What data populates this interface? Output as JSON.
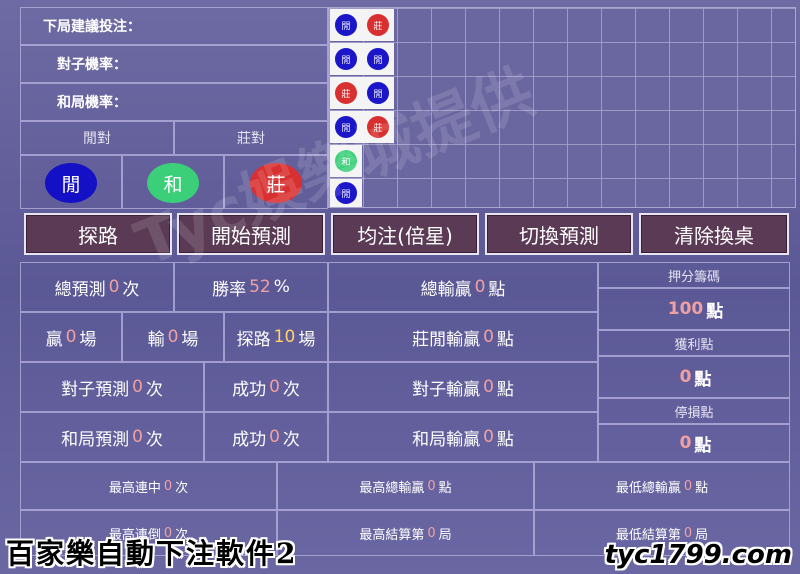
{
  "labels": {
    "next_bet": "下局建議投注：",
    "pair_rate": "對子機率：",
    "tie_rate": "和局機率："
  },
  "pairs": {
    "player_pair": "閒對",
    "banker_pair": "莊對"
  },
  "balls": {
    "player": "閒",
    "tie": "和",
    "banker": "莊"
  },
  "beads": {
    "player": "閒",
    "banker": "莊",
    "tie": "和"
  },
  "buttons": {
    "explore": "探路",
    "start_predict": "開始預測",
    "flat_bet": "均注(倍星)",
    "switch_predict": "切換預測",
    "clear_table": "清除換桌"
  },
  "stats": {
    "total_predict": {
      "label": "總預測",
      "value": "0",
      "unit": "次"
    },
    "win_rate": {
      "label": "勝率",
      "value": "52",
      "unit": "%"
    },
    "total_net": {
      "label": "總輸贏",
      "value": "0",
      "unit": "點"
    },
    "wins": {
      "label": "贏",
      "value": "0",
      "unit": "場"
    },
    "losses": {
      "label": "輸",
      "value": "0",
      "unit": "場"
    },
    "explore_count": {
      "label": "探路",
      "value": "10",
      "unit": "場"
    },
    "bp_net": {
      "label": "莊閒輸贏",
      "value": "0",
      "unit": "點"
    },
    "pair_predict": {
      "label": "對子預測",
      "value": "0",
      "unit": "次"
    },
    "pair_success": {
      "label": "成功",
      "value": "0",
      "unit": "次"
    },
    "pair_net": {
      "label": "對子輸贏",
      "value": "0",
      "unit": "點"
    },
    "tie_predict": {
      "label": "和局預測",
      "value": "0",
      "unit": "次"
    },
    "tie_success": {
      "label": "成功",
      "value": "0",
      "unit": "次"
    },
    "tie_net": {
      "label": "和局輸贏",
      "value": "0",
      "unit": "點"
    }
  },
  "side": {
    "chip_label": "押分籌碼",
    "chip_value": "100",
    "chip_unit": "點",
    "profit_label": "獲利點",
    "profit_value": "0",
    "profit_unit": "點",
    "stop_label": "停損點",
    "stop_value": "0",
    "stop_unit": "點"
  },
  "records": {
    "max_win_streak": {
      "label": "最高連中",
      "value": "0",
      "unit": "次"
    },
    "max_total_win": {
      "label": "最高總輸贏",
      "value": "0",
      "unit": "點"
    },
    "min_total_win": {
      "label": "最低總輸贏",
      "value": "0",
      "unit": "點"
    },
    "max_lose_streak": {
      "label": "最高連倒",
      "value": "0",
      "unit": "次"
    },
    "max_settle_round": {
      "label": "最高結算第",
      "value": "0",
      "unit": "局"
    },
    "min_settle_round": {
      "label": "最低結算第",
      "value": "0",
      "unit": "局"
    }
  },
  "watermark": "Tyc娛樂城提供",
  "footer": {
    "title": "百家樂自動下注軟件2",
    "site": "tyc1799.com"
  },
  "colors": {
    "player": "#1b16c8",
    "banker": "#d83030",
    "tie": "#3ccf7a",
    "button_bg": "#5a3a55"
  }
}
